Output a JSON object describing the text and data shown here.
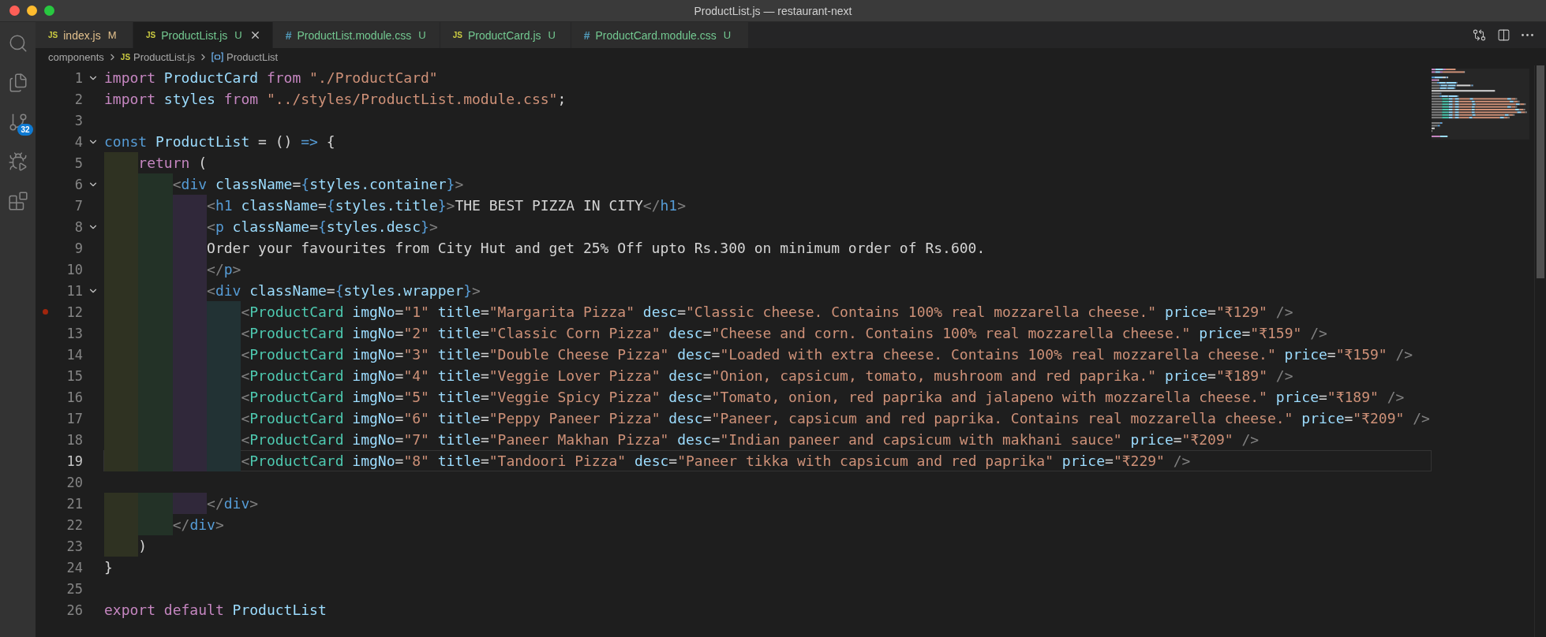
{
  "window": {
    "title": "ProductList.js — restaurant-next"
  },
  "activity_bar": [
    {
      "kind": "search",
      "selected": false
    },
    {
      "kind": "explorer",
      "selected": false
    },
    {
      "kind": "source-control",
      "selected": false,
      "badge": "32"
    },
    {
      "kind": "run-debug",
      "selected": false
    },
    {
      "kind": "extensions",
      "selected": false
    }
  ],
  "tabs": [
    {
      "icon": "JS",
      "kind": "js",
      "label": "index.js",
      "status": "M",
      "color": "#e2c08d",
      "selected": false
    },
    {
      "icon": "JS",
      "kind": "js",
      "label": "ProductList.js",
      "status": "U",
      "color": "#73c991",
      "selected": true
    },
    {
      "icon": "#",
      "kind": "css",
      "label": "ProductList.module.css",
      "status": "U",
      "color": "#73c991",
      "selected": false
    },
    {
      "icon": "JS",
      "kind": "js",
      "label": "ProductCard.js",
      "status": "U",
      "color": "#73c991",
      "selected": false
    },
    {
      "icon": "#",
      "kind": "css",
      "label": "ProductCard.module.css",
      "status": "U",
      "color": "#73c991",
      "selected": false
    }
  ],
  "editor_actions": [
    {
      "kind": "compare"
    },
    {
      "kind": "split"
    },
    {
      "kind": "more"
    }
  ],
  "breadcrumbs": [
    {
      "kind": "folder",
      "label": "components"
    },
    {
      "kind": "file",
      "icon": "JS",
      "label": "ProductList.js"
    },
    {
      "kind": "symbol",
      "label": "ProductList"
    }
  ],
  "lines": [
    {
      "number": "1",
      "fold": true,
      "breakpoint": false,
      "current": false,
      "tokens": [
        {
          "kind": "kw",
          "text": "import"
        },
        {
          "kind": "var",
          "text": " ProductCard "
        },
        {
          "kind": "kw",
          "text": "from"
        },
        {
          "kind": "str",
          "text": " \"./ProductCard\""
        }
      ]
    },
    {
      "number": "2",
      "fold": false,
      "breakpoint": false,
      "current": false,
      "tokens": [
        {
          "kind": "kw",
          "text": "import"
        },
        {
          "kind": "var",
          "text": " styles "
        },
        {
          "kind": "kw",
          "text": "from"
        },
        {
          "kind": "str",
          "text": " \"../styles/ProductList.module.css\""
        },
        {
          "kind": "plain",
          "text": ";"
        }
      ]
    },
    {
      "number": "3",
      "fold": false,
      "breakpoint": false,
      "current": false
    },
    {
      "number": "4",
      "fold": true,
      "breakpoint": false,
      "current": false,
      "tokens": [
        {
          "kind": "storage",
          "text": "const"
        },
        {
          "kind": "var",
          "text": " ProductList "
        },
        {
          "kind": "plain",
          "text": "= () "
        },
        {
          "kind": "storage",
          "text": "=>"
        },
        {
          "kind": "plain",
          "text": " {"
        }
      ]
    },
    {
      "number": "5",
      "fold": false,
      "breakpoint": false,
      "current": false,
      "tokens": [
        {
          "kind": "kw",
          "text": "    return"
        },
        {
          "kind": "plain",
          "text": " ("
        }
      ]
    },
    {
      "number": "6",
      "fold": true,
      "breakpoint": false,
      "current": false,
      "tokens": [
        {
          "kind": "punct",
          "text": "        <"
        },
        {
          "kind": "tag",
          "text": "div"
        },
        {
          "kind": "attr",
          "text": " className"
        },
        {
          "kind": "plain",
          "text": "="
        },
        {
          "kind": "brace",
          "text": "{"
        },
        {
          "kind": "var",
          "text": "styles.container"
        },
        {
          "kind": "brace",
          "text": "}"
        },
        {
          "kind": "punct",
          "text": ">"
        }
      ]
    },
    {
      "number": "7",
      "fold": false,
      "breakpoint": false,
      "current": false,
      "tokens": [
        {
          "kind": "punct",
          "text": "            <"
        },
        {
          "kind": "tag",
          "text": "h1"
        },
        {
          "kind": "attr",
          "text": " className"
        },
        {
          "kind": "plain",
          "text": "="
        },
        {
          "kind": "brace",
          "text": "{"
        },
        {
          "kind": "var",
          "text": "styles.title"
        },
        {
          "kind": "brace",
          "text": "}"
        },
        {
          "kind": "punct",
          "text": ">"
        },
        {
          "kind": "plain",
          "text": "THE BEST PIZZA IN CITY"
        },
        {
          "kind": "punct",
          "text": "</"
        },
        {
          "kind": "tag",
          "text": "h1"
        },
        {
          "kind": "punct",
          "text": ">"
        }
      ]
    },
    {
      "number": "8",
      "fold": true,
      "breakpoint": false,
      "current": false,
      "tokens": [
        {
          "kind": "punct",
          "text": "            <"
        },
        {
          "kind": "tag",
          "text": "p"
        },
        {
          "kind": "attr",
          "text": " className"
        },
        {
          "kind": "plain",
          "text": "="
        },
        {
          "kind": "brace",
          "text": "{"
        },
        {
          "kind": "var",
          "text": "styles.desc"
        },
        {
          "kind": "brace",
          "text": "}"
        },
        {
          "kind": "punct",
          "text": ">"
        }
      ]
    },
    {
      "number": "9",
      "fold": false,
      "breakpoint": false,
      "current": false,
      "tokens": [
        {
          "kind": "plain",
          "text": "            Order your favourites from City Hut and get 25% Off upto Rs.300 on minimum order of Rs.600."
        }
      ]
    },
    {
      "number": "10",
      "fold": false,
      "breakpoint": false,
      "current": false,
      "tokens": [
        {
          "kind": "punct",
          "text": "            </"
        },
        {
          "kind": "tag",
          "text": "p"
        },
        {
          "kind": "punct",
          "text": ">"
        }
      ]
    },
    {
      "number": "11",
      "fold": true,
      "breakpoint": false,
      "current": false,
      "tokens": [
        {
          "kind": "punct",
          "text": "            <"
        },
        {
          "kind": "tag",
          "text": "div"
        },
        {
          "kind": "attr",
          "text": " className"
        },
        {
          "kind": "plain",
          "text": "="
        },
        {
          "kind": "brace",
          "text": "{"
        },
        {
          "kind": "var",
          "text": "styles.wrapper"
        },
        {
          "kind": "brace",
          "text": "}"
        },
        {
          "kind": "punct",
          "text": ">"
        }
      ]
    },
    {
      "number": "12",
      "fold": false,
      "breakpoint": true,
      "current": false,
      "tokens": [
        {
          "kind": "punct",
          "text": "                <"
        },
        {
          "kind": "comp",
          "text": "ProductCard"
        },
        {
          "kind": "attr",
          "text": " imgNo"
        },
        {
          "kind": "plain",
          "text": "="
        },
        {
          "kind": "str",
          "text": "\"1\""
        },
        {
          "kind": "attr",
          "text": " title"
        },
        {
          "kind": "plain",
          "text": "="
        },
        {
          "kind": "str",
          "text": "\"Margarita Pizza\""
        },
        {
          "kind": "attr",
          "text": " desc"
        },
        {
          "kind": "plain",
          "text": "="
        },
        {
          "kind": "str",
          "text": "\"Classic cheese. Contains 100% real mozzarella cheese.\""
        },
        {
          "kind": "attr",
          "text": " price"
        },
        {
          "kind": "plain",
          "text": "="
        },
        {
          "kind": "str",
          "text": "\"₹129\""
        },
        {
          "kind": "punct",
          "text": " />"
        }
      ]
    },
    {
      "number": "13",
      "fold": false,
      "breakpoint": false,
      "current": false,
      "tokens": [
        {
          "kind": "punct",
          "text": "                <"
        },
        {
          "kind": "comp",
          "text": "ProductCard"
        },
        {
          "kind": "attr",
          "text": " imgNo"
        },
        {
          "kind": "plain",
          "text": "="
        },
        {
          "kind": "str",
          "text": "\"2\""
        },
        {
          "kind": "attr",
          "text": " title"
        },
        {
          "kind": "plain",
          "text": "="
        },
        {
          "kind": "str",
          "text": "\"Classic Corn Pizza\""
        },
        {
          "kind": "attr",
          "text": " desc"
        },
        {
          "kind": "plain",
          "text": "="
        },
        {
          "kind": "str",
          "text": "\"Cheese and corn. Contains 100% real mozzarella cheese.\""
        },
        {
          "kind": "attr",
          "text": " price"
        },
        {
          "kind": "plain",
          "text": "="
        },
        {
          "kind": "str",
          "text": "\"₹159\""
        },
        {
          "kind": "punct",
          "text": " />"
        }
      ]
    },
    {
      "number": "14",
      "fold": false,
      "breakpoint": false,
      "current": false,
      "tokens": [
        {
          "kind": "punct",
          "text": "                <"
        },
        {
          "kind": "comp",
          "text": "ProductCard"
        },
        {
          "kind": "attr",
          "text": " imgNo"
        },
        {
          "kind": "plain",
          "text": "="
        },
        {
          "kind": "str",
          "text": "\"3\""
        },
        {
          "kind": "attr",
          "text": " title"
        },
        {
          "kind": "plain",
          "text": "="
        },
        {
          "kind": "str",
          "text": "\"Double Cheese Pizza\""
        },
        {
          "kind": "attr",
          "text": " desc"
        },
        {
          "kind": "plain",
          "text": "="
        },
        {
          "kind": "str",
          "text": "\"Loaded with extra cheese. Contains 100% real mozzarella cheese.\""
        },
        {
          "kind": "attr",
          "text": " price"
        },
        {
          "kind": "plain",
          "text": "="
        },
        {
          "kind": "str",
          "text": "\"₹159\""
        },
        {
          "kind": "punct",
          "text": " />"
        }
      ]
    },
    {
      "number": "15",
      "fold": false,
      "breakpoint": false,
      "current": false,
      "tokens": [
        {
          "kind": "punct",
          "text": "                <"
        },
        {
          "kind": "comp",
          "text": "ProductCard"
        },
        {
          "kind": "attr",
          "text": " imgNo"
        },
        {
          "kind": "plain",
          "text": "="
        },
        {
          "kind": "str",
          "text": "\"4\""
        },
        {
          "kind": "attr",
          "text": " title"
        },
        {
          "kind": "plain",
          "text": "="
        },
        {
          "kind": "str",
          "text": "\"Veggie Lover Pizza\""
        },
        {
          "kind": "attr",
          "text": " desc"
        },
        {
          "kind": "plain",
          "text": "="
        },
        {
          "kind": "str",
          "text": "\"Onion, capsicum, tomato, mushroom and red paprika.\""
        },
        {
          "kind": "attr",
          "text": " price"
        },
        {
          "kind": "plain",
          "text": "="
        },
        {
          "kind": "str",
          "text": "\"₹189\""
        },
        {
          "kind": "punct",
          "text": " />"
        }
      ]
    },
    {
      "number": "16",
      "fold": false,
      "breakpoint": false,
      "current": false,
      "tokens": [
        {
          "kind": "punct",
          "text": "                <"
        },
        {
          "kind": "comp",
          "text": "ProductCard"
        },
        {
          "kind": "attr",
          "text": " imgNo"
        },
        {
          "kind": "plain",
          "text": "="
        },
        {
          "kind": "str",
          "text": "\"5\""
        },
        {
          "kind": "attr",
          "text": " title"
        },
        {
          "kind": "plain",
          "text": "="
        },
        {
          "kind": "str",
          "text": "\"Veggie Spicy Pizza\""
        },
        {
          "kind": "attr",
          "text": " desc"
        },
        {
          "kind": "plain",
          "text": "="
        },
        {
          "kind": "str",
          "text": "\"Tomato, onion, red paprika and jalapeno with mozzarella cheese.\""
        },
        {
          "kind": "attr",
          "text": " price"
        },
        {
          "kind": "plain",
          "text": "="
        },
        {
          "kind": "str",
          "text": "\"₹189\""
        },
        {
          "kind": "punct",
          "text": " />"
        }
      ]
    },
    {
      "number": "17",
      "fold": false,
      "breakpoint": false,
      "current": false,
      "tokens": [
        {
          "kind": "punct",
          "text": "                <"
        },
        {
          "kind": "comp",
          "text": "ProductCard"
        },
        {
          "kind": "attr",
          "text": " imgNo"
        },
        {
          "kind": "plain",
          "text": "="
        },
        {
          "kind": "str",
          "text": "\"6\""
        },
        {
          "kind": "attr",
          "text": " title"
        },
        {
          "kind": "plain",
          "text": "="
        },
        {
          "kind": "str",
          "text": "\"Peppy Paneer Pizza\""
        },
        {
          "kind": "attr",
          "text": " desc"
        },
        {
          "kind": "plain",
          "text": "="
        },
        {
          "kind": "str",
          "text": "\"Paneer, capsicum and red paprika. Contains real mozzarella cheese.\""
        },
        {
          "kind": "attr",
          "text": " price"
        },
        {
          "kind": "plain",
          "text": "="
        },
        {
          "kind": "str",
          "text": "\"₹209\""
        },
        {
          "kind": "punct",
          "text": " />"
        }
      ]
    },
    {
      "number": "18",
      "fold": false,
      "breakpoint": false,
      "current": false,
      "tokens": [
        {
          "kind": "punct",
          "text": "                <"
        },
        {
          "kind": "comp",
          "text": "ProductCard"
        },
        {
          "kind": "attr",
          "text": " imgNo"
        },
        {
          "kind": "plain",
          "text": "="
        },
        {
          "kind": "str",
          "text": "\"7\""
        },
        {
          "kind": "attr",
          "text": " title"
        },
        {
          "kind": "plain",
          "text": "="
        },
        {
          "kind": "str",
          "text": "\"Paneer Makhan Pizza\""
        },
        {
          "kind": "attr",
          "text": " desc"
        },
        {
          "kind": "plain",
          "text": "="
        },
        {
          "kind": "str",
          "text": "\"Indian paneer and capsicum with makhani sauce\""
        },
        {
          "kind": "attr",
          "text": " price"
        },
        {
          "kind": "plain",
          "text": "="
        },
        {
          "kind": "str",
          "text": "\"₹209\""
        },
        {
          "kind": "punct",
          "text": " />"
        }
      ]
    },
    {
      "number": "19",
      "fold": false,
      "breakpoint": false,
      "current": true,
      "tokens": [
        {
          "kind": "punct",
          "text": "                <"
        },
        {
          "kind": "comp",
          "text": "ProductCard"
        },
        {
          "kind": "attr",
          "text": " imgNo"
        },
        {
          "kind": "plain",
          "text": "="
        },
        {
          "kind": "str",
          "text": "\"8\""
        },
        {
          "kind": "attr",
          "text": " title"
        },
        {
          "kind": "plain",
          "text": "="
        },
        {
          "kind": "str",
          "text": "\"Tandoori Pizza\""
        },
        {
          "kind": "attr",
          "text": " desc"
        },
        {
          "kind": "plain",
          "text": "="
        },
        {
          "kind": "str",
          "text": "\"Paneer tikka with capsicum and red paprika\""
        },
        {
          "kind": "attr",
          "text": " price"
        },
        {
          "kind": "plain",
          "text": "="
        },
        {
          "kind": "str",
          "text": "\"₹229\""
        },
        {
          "kind": "punct",
          "text": " />"
        }
      ]
    },
    {
      "number": "20",
      "fold": false,
      "breakpoint": false,
      "current": false
    },
    {
      "number": "21",
      "fold": false,
      "breakpoint": false,
      "current": false,
      "tokens": [
        {
          "kind": "punct",
          "text": "            </"
        },
        {
          "kind": "tag",
          "text": "div"
        },
        {
          "kind": "punct",
          "text": ">"
        }
      ]
    },
    {
      "number": "22",
      "fold": false,
      "breakpoint": false,
      "current": false,
      "tokens": [
        {
          "kind": "punct",
          "text": "        </"
        },
        {
          "kind": "tag",
          "text": "div"
        },
        {
          "kind": "punct",
          "text": ">"
        }
      ]
    },
    {
      "number": "23",
      "fold": false,
      "breakpoint": false,
      "current": false,
      "tokens": [
        {
          "kind": "plain",
          "text": "    )"
        }
      ]
    },
    {
      "number": "24",
      "fold": false,
      "breakpoint": false,
      "current": false,
      "tokens": [
        {
          "kind": "plain",
          "text": "}"
        }
      ]
    },
    {
      "number": "25",
      "fold": false,
      "breakpoint": false,
      "current": false
    },
    {
      "number": "26",
      "fold": false,
      "breakpoint": false,
      "current": false,
      "tokens": [
        {
          "kind": "kw",
          "text": "export default"
        },
        {
          "kind": "var",
          "text": " ProductList"
        }
      ]
    }
  ]
}
